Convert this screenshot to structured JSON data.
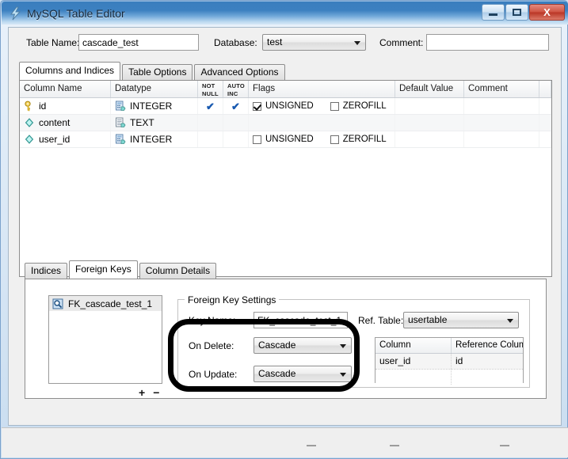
{
  "window": {
    "title": "MySQL Table Editor",
    "icon": "lightning-bolt-icon",
    "minimize_label": "Minimize",
    "maximize_label": "Maximize",
    "close_label": "X"
  },
  "header": {
    "table_name_label": "Table Name:",
    "table_name_value": "cascade_test",
    "database_label": "Database:",
    "database_value": "test",
    "comment_label": "Comment:",
    "comment_value": ""
  },
  "main_tabs": [
    {
      "label": "Columns and Indices",
      "active": true
    },
    {
      "label": "Table Options",
      "active": false
    },
    {
      "label": "Advanced Options",
      "active": false
    }
  ],
  "columns_grid": {
    "headers": [
      {
        "label": "Column Name"
      },
      {
        "label": "Datatype"
      },
      {
        "line1": "NOT",
        "line2": "NULL"
      },
      {
        "line1": "AUTO",
        "line2": "INC"
      },
      {
        "label": "Flags"
      },
      {
        "label": "Default Value"
      },
      {
        "label": "Comment"
      }
    ],
    "rows": [
      {
        "icon": "primary-key-icon",
        "name": "id",
        "datatype_icon": "integer-datatype-icon",
        "datatype": "INTEGER",
        "not_null": true,
        "auto_inc": true,
        "flags": [
          {
            "label": "UNSIGNED",
            "checked": true
          },
          {
            "label": "ZEROFILL",
            "checked": false
          }
        ],
        "default_value": "",
        "comment": ""
      },
      {
        "icon": "column-icon",
        "name": "content",
        "datatype_icon": "text-datatype-icon",
        "datatype": "TEXT",
        "not_null": false,
        "auto_inc": false,
        "flags": [],
        "default_value": "",
        "comment": ""
      },
      {
        "icon": "column-icon",
        "name": "user_id",
        "datatype_icon": "integer-datatype-icon",
        "datatype": "INTEGER",
        "not_null": false,
        "auto_inc": false,
        "flags": [
          {
            "label": "UNSIGNED",
            "checked": false
          },
          {
            "label": "ZEROFILL",
            "checked": false
          }
        ],
        "default_value": "",
        "comment": ""
      }
    ]
  },
  "bottom_tabs": [
    {
      "label": "Indices",
      "active": false
    },
    {
      "label": "Foreign Keys",
      "active": true
    },
    {
      "label": "Column Details",
      "active": false
    }
  ],
  "foreign_keys": {
    "list": [
      {
        "icon": "foreign-key-icon",
        "label": "FK_cascade_test_1",
        "selected": true
      }
    ],
    "add_label": "+",
    "remove_label": "−",
    "settings": {
      "group_title": "Foreign Key Settings",
      "key_name_label": "Key Name:",
      "key_name_value": "FK_cascade_test_1",
      "ref_table_label": "Ref. Table:",
      "ref_table_value": "usertable",
      "on_delete_label": "On Delete:",
      "on_delete_value": "Cascade",
      "on_update_label": "On Update:",
      "on_update_value": "Cascade",
      "mapping_headers": [
        "Column",
        "Reference Column"
      ],
      "mapping_rows": [
        {
          "column": "user_id",
          "reference_column": "id"
        }
      ]
    }
  },
  "status_bar": {
    "items": [
      "—",
      "—",
      "—"
    ]
  },
  "colors": {
    "title_blue": "#3a7ebe",
    "close_red": "#cf5443",
    "tick_blue": "#1859b0",
    "annotation_black": "#000000",
    "client_gray": "#f0f0f0"
  }
}
